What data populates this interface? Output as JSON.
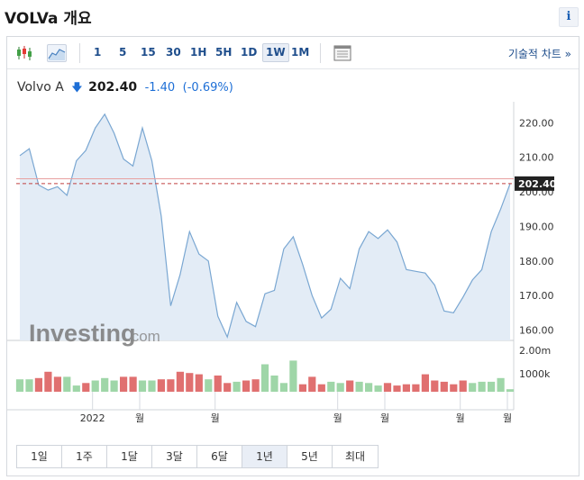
{
  "header": {
    "title": "VOLVa 개요",
    "info_label": "i"
  },
  "toolbar": {
    "intervals": [
      {
        "label": "1",
        "active": false
      },
      {
        "label": "5",
        "active": false
      },
      {
        "label": "15",
        "active": false
      },
      {
        "label": "30",
        "active": false
      },
      {
        "label": "1H",
        "active": false
      },
      {
        "label": "5H",
        "active": false
      },
      {
        "label": "1D",
        "active": false
      },
      {
        "label": "1W",
        "active": true
      },
      {
        "label": "1M",
        "active": false
      }
    ],
    "tech_chart_label": "기술적 차트 »"
  },
  "quote": {
    "name": "Volvo A",
    "price": "202.40",
    "change": "-1.40",
    "change_pct": "(-0.69%)",
    "direction": "down"
  },
  "colors": {
    "line": "#7aa7d2",
    "area": "#e3ecf6",
    "up_volume": "#9fd6a8",
    "down_volume": "#e07070",
    "price_label": "#222222",
    "current_line": "#c04040",
    "accent": "#1e6fd6"
  },
  "chart_data": {
    "type": "area",
    "title": "",
    "watermark": "Investing.com",
    "ylim": [
      157,
      224
    ],
    "y_ticks": [
      "220.00",
      "210.00",
      "200.00",
      "190.00",
      "180.00",
      "170.00",
      "160.00"
    ],
    "current_price_label": "202.40",
    "current_price": 202.4,
    "reference_price": 203.8,
    "x_labels": [
      "2022",
      "월",
      "월",
      "월",
      "월",
      "월",
      "월"
    ],
    "price": [
      210.5,
      212.5,
      202.0,
      200.5,
      201.5,
      199.0,
      209.0,
      212.0,
      218.5,
      222.5,
      217.0,
      209.5,
      207.5,
      218.5,
      209.0,
      193.0,
      167.0,
      176.0,
      188.5,
      182.0,
      180.0,
      164.0,
      158.0,
      168.0,
      162.5,
      161.0,
      170.5,
      171.5,
      183.5,
      187.0,
      179.0,
      170.0,
      163.5,
      166.0,
      175.0,
      172.0,
      183.5,
      188.5,
      186.5,
      189.0,
      185.5,
      177.5,
      177.0,
      176.5,
      173.0,
      165.5,
      165.0,
      169.5,
      174.5,
      177.5,
      188.5,
      195.0,
      202.4
    ],
    "volume_axis_labels": [
      "2.00m",
      "1000k"
    ],
    "volume": [
      {
        "v": 0.5,
        "up": true
      },
      {
        "v": 0.5,
        "up": true
      },
      {
        "v": 0.55,
        "up": false
      },
      {
        "v": 0.8,
        "up": false
      },
      {
        "v": 0.6,
        "up": false
      },
      {
        "v": 0.6,
        "up": true
      },
      {
        "v": 0.25,
        "up": true
      },
      {
        "v": 0.35,
        "up": false
      },
      {
        "v": 0.45,
        "up": true
      },
      {
        "v": 0.55,
        "up": true
      },
      {
        "v": 0.45,
        "up": true
      },
      {
        "v": 0.6,
        "up": false
      },
      {
        "v": 0.6,
        "up": false
      },
      {
        "v": 0.45,
        "up": true
      },
      {
        "v": 0.45,
        "up": true
      },
      {
        "v": 0.5,
        "up": false
      },
      {
        "v": 0.5,
        "up": false
      },
      {
        "v": 0.8,
        "up": false
      },
      {
        "v": 0.75,
        "up": false
      },
      {
        "v": 0.7,
        "up": false
      },
      {
        "v": 0.5,
        "up": true
      },
      {
        "v": 0.65,
        "up": false
      },
      {
        "v": 0.35,
        "up": false
      },
      {
        "v": 0.4,
        "up": true
      },
      {
        "v": 0.45,
        "up": false
      },
      {
        "v": 0.5,
        "up": false
      },
      {
        "v": 1.1,
        "up": true
      },
      {
        "v": 0.65,
        "up": true
      },
      {
        "v": 0.35,
        "up": true
      },
      {
        "v": 1.25,
        "up": true
      },
      {
        "v": 0.3,
        "up": false
      },
      {
        "v": 0.6,
        "up": false
      },
      {
        "v": 0.3,
        "up": false
      },
      {
        "v": 0.4,
        "up": true
      },
      {
        "v": 0.35,
        "up": true
      },
      {
        "v": 0.45,
        "up": false
      },
      {
        "v": 0.4,
        "up": true
      },
      {
        "v": 0.35,
        "up": true
      },
      {
        "v": 0.25,
        "up": true
      },
      {
        "v": 0.35,
        "up": false
      },
      {
        "v": 0.25,
        "up": false
      },
      {
        "v": 0.3,
        "up": false
      },
      {
        "v": 0.3,
        "up": false
      },
      {
        "v": 0.7,
        "up": false
      },
      {
        "v": 0.45,
        "up": false
      },
      {
        "v": 0.4,
        "up": false
      },
      {
        "v": 0.3,
        "up": false
      },
      {
        "v": 0.45,
        "up": false
      },
      {
        "v": 0.35,
        "up": true
      },
      {
        "v": 0.4,
        "up": true
      },
      {
        "v": 0.4,
        "up": true
      },
      {
        "v": 0.55,
        "up": true
      },
      {
        "v": 0.1,
        "up": true
      }
    ]
  },
  "range_buttons": [
    {
      "label": "1일",
      "active": false
    },
    {
      "label": "1주",
      "active": false
    },
    {
      "label": "1달",
      "active": false
    },
    {
      "label": "3달",
      "active": false
    },
    {
      "label": "6달",
      "active": false
    },
    {
      "label": "1년",
      "active": true
    },
    {
      "label": "5년",
      "active": false
    },
    {
      "label": "최대",
      "active": false
    }
  ]
}
